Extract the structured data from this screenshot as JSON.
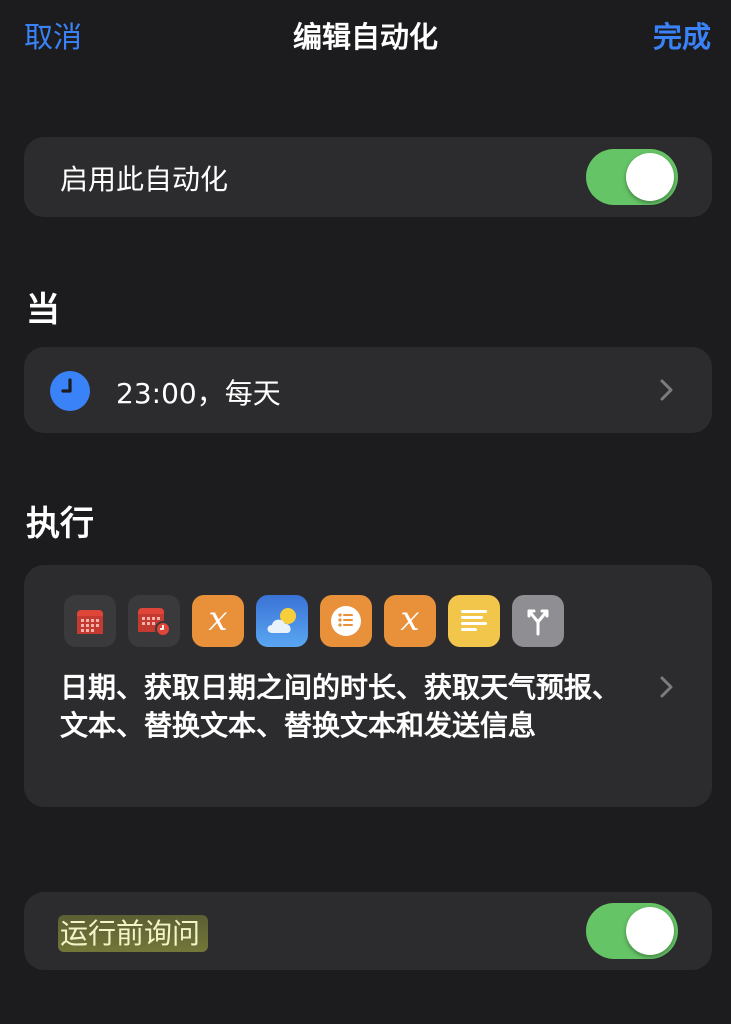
{
  "nav": {
    "cancel_label": "取消",
    "title": "编辑自动化",
    "done_label": "完成"
  },
  "enable_row": {
    "label": "启用此自动化",
    "toggle_on": true
  },
  "when_section": {
    "heading": "当",
    "trigger": {
      "icon": "clock-icon",
      "label": "23:00，每天"
    }
  },
  "do_section": {
    "heading": "执行",
    "action_icons": [
      {
        "name": "calendar-icon",
        "color": "#e0453a"
      },
      {
        "name": "calendar-timer-icon",
        "color": "#e0453a"
      },
      {
        "name": "variable-x-icon",
        "color": "#e8903a"
      },
      {
        "name": "weather-icon",
        "color": "#3a72d6"
      },
      {
        "name": "list-icon",
        "color": "#e8903a"
      },
      {
        "name": "variable-x-icon",
        "color": "#e8903a"
      },
      {
        "name": "text-lines-icon",
        "color": "#f2c64a"
      },
      {
        "name": "branch-icon",
        "color": "#8e8e93"
      }
    ],
    "actions_text": "日期、获取日期之间的时长、获取天气预报、文本、替换文本、替换文本和发送信息"
  },
  "ask_row": {
    "label": "运行前询问",
    "toggle_on": true
  },
  "colors": {
    "background": "#1c1c1e",
    "card": "#2c2c2e",
    "accent_blue": "#3a82f7",
    "toggle_green": "#65c466"
  }
}
